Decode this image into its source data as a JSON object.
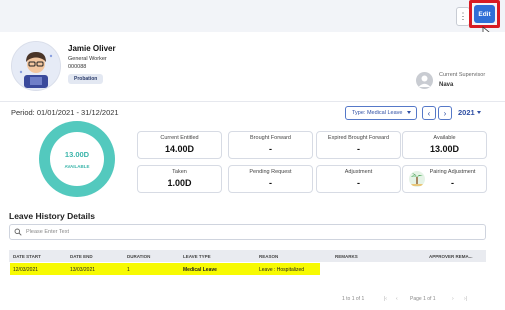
{
  "toolbar": {
    "more_label": "⋮",
    "edit_label": "Edit"
  },
  "employee": {
    "name": "Jamie Oliver",
    "role": "General Worker",
    "id": "000088",
    "status_badge": "Probation"
  },
  "supervisor": {
    "label": "Current Supervisor",
    "name": "Nava"
  },
  "period": {
    "text": "Period: 01/01/2021 - 31/12/2021",
    "type_select": "Type: Medical Leave",
    "prev_label": "‹",
    "next_label": "›",
    "year": "2021"
  },
  "donut": {
    "value": "13.00D",
    "label": "AVAILABLE",
    "color": "#53c9be"
  },
  "stats": [
    {
      "label": "Current Entitled",
      "value": "14.00D"
    },
    {
      "label": "Brought Forward",
      "value": "-"
    },
    {
      "label": "Expired Brought Forward",
      "value": "-"
    },
    {
      "label": "Available",
      "value": "13.00D"
    },
    {
      "label": "Taken",
      "value": "1.00D"
    },
    {
      "label": "Pending Request",
      "value": "-"
    },
    {
      "label": "Adjustment",
      "value": "-"
    },
    {
      "label": "Pairing Adjustment",
      "value": "-"
    }
  ],
  "history": {
    "title": "Leave History Details",
    "search_placeholder": "Please Enter Text",
    "columns": [
      "DATE START",
      "DATE END",
      "DURATION",
      "LEAVE TYPE",
      "REASON",
      "REMARKS",
      "APPROVER REMA..."
    ],
    "rows": [
      [
        "12/03/2021",
        "13/03/2021",
        "1",
        "Medical Leave",
        "Leave : Hospitalized",
        "",
        ""
      ]
    ],
    "highlight_color": "#f7fa02"
  },
  "pagination": {
    "range": "1 to 1 of 1",
    "page_text": "Page  1  of  1"
  },
  "colors": {
    "accent": "#2f6fd6",
    "highlight_border": "#d81b23"
  }
}
